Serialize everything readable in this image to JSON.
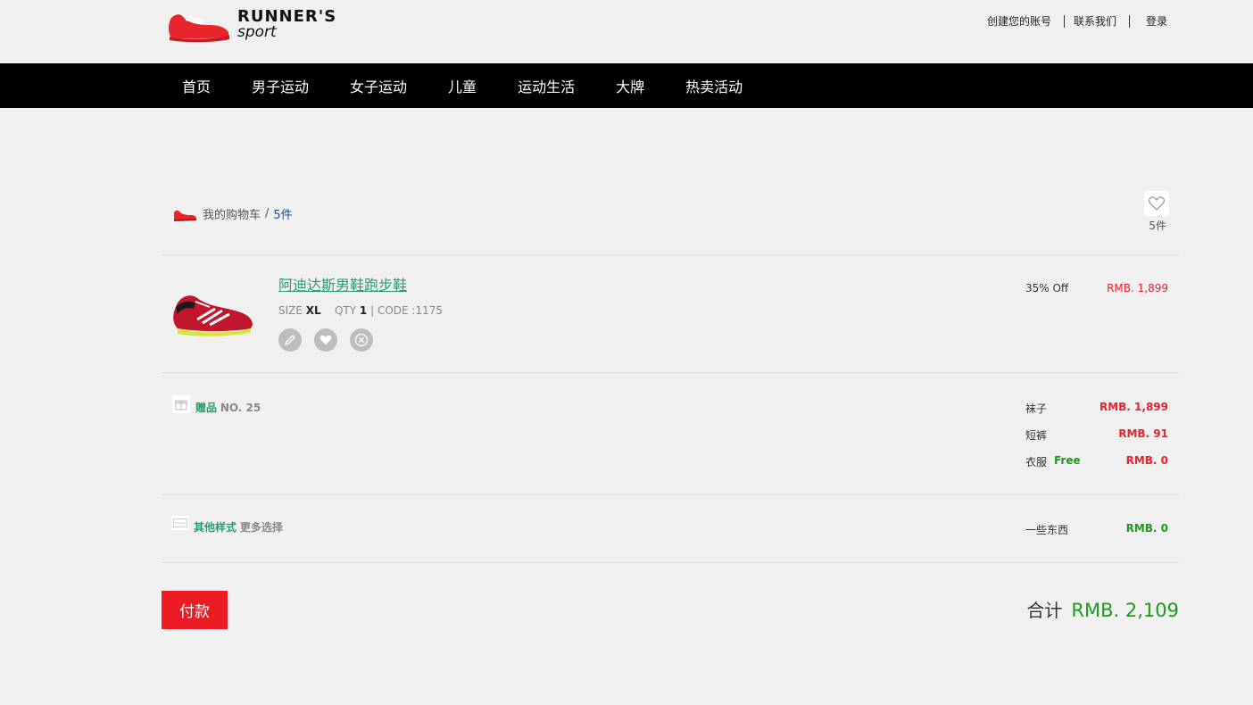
{
  "brand": {
    "name": "RUNNER'S",
    "sub": "sport",
    "accent": "#e8242c"
  },
  "top_links": {
    "create_account": "创建您的账号",
    "contact": "联系我们",
    "login": "登录"
  },
  "nav": {
    "items": [
      "首页",
      "男子运动",
      "女子运动",
      "儿童",
      "运动生活",
      "大牌",
      "热卖活动"
    ]
  },
  "cart": {
    "label": "我的购物车",
    "separator": "/",
    "count": "5件",
    "fav_count": "5件"
  },
  "product": {
    "name": "阿迪达斯男鞋跑步鞋",
    "size_label": "SIZE",
    "size": "XL",
    "qty_label": "QTY",
    "qty": "1",
    "code": "| CODE :1175",
    "discount": "35% Off",
    "price": "RMB. 1,899",
    "icons": [
      "pencil-icon",
      "heart-icon",
      "close-icon"
    ]
  },
  "gift": {
    "label": "赠品",
    "no": "NO. 25",
    "lines": [
      {
        "name": "袜子",
        "free": "",
        "value": "RMB. 1,899"
      },
      {
        "name": "短裤",
        "free": "",
        "value": "RMB. 91"
      },
      {
        "name": "衣服",
        "free": "Free",
        "value": "RMB. 0"
      }
    ]
  },
  "other": {
    "label": "其他样式",
    "more": "更多选择",
    "item_name": "一些东西",
    "item_value": "RMB. 0"
  },
  "footer": {
    "pay_label": "付款",
    "total_label": "合计",
    "total_value": "RMB. 2,109"
  }
}
